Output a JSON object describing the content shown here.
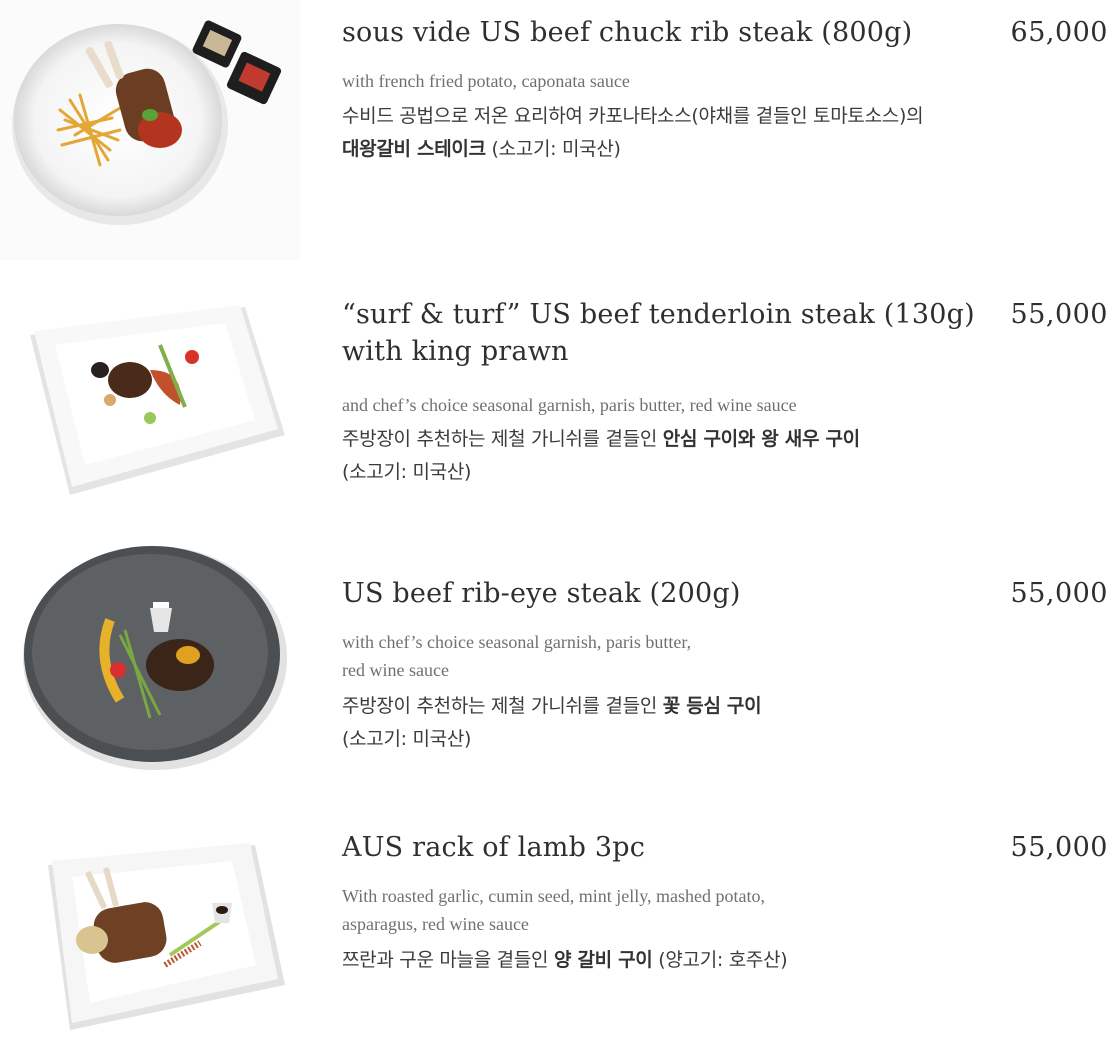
{
  "items": [
    {
      "title": "sous vide US beef chuck rib steak (800g)",
      "price": "65,000",
      "desc_lines": [
        "with french fried potato, caponata sauce"
      ],
      "kr_line1_pre": "수비드 공법으로 저온 요리하여 카포나타소스(야채를 곁들인 토마토소스)의",
      "kr_line2_bold": "대왕갈비 스테이크",
      "kr_line2_post": " (소고기: 미국산)",
      "photo": "steak-on-round-plate-with-fries"
    },
    {
      "title_line1": "“surf & turf” US beef tenderloin steak (130g)",
      "title_line2": "with king prawn",
      "price": "55,000",
      "desc_lines": [
        "and chef’s choice seasonal garnish, paris butter, red wine sauce"
      ],
      "kr_line1_pre": "주방장이 추천하는 제철 가니쉬를 곁들인 ",
      "kr_line1_bold": "안심 구이와 왕 새우 구이",
      "kr_line2_post": "(소고기: 미국산)",
      "photo": "tenderloin-and-prawn-on-square-plate"
    },
    {
      "title": "US beef rib-eye steak (200g)",
      "price": "55,000",
      "desc_lines": [
        "with chef’s choice seasonal garnish, paris butter,",
        "red wine sauce"
      ],
      "kr_line1_pre": "주방장이 추천하는 제철 가니쉬를 곁들인 ",
      "kr_line1_bold": "꽃 등심 구이",
      "kr_line2_post": "(소고기: 미국산)",
      "photo": "rib-eye-on-dark-round-plate"
    },
    {
      "title": "AUS rack of lamb 3pc",
      "price": "55,000",
      "desc_lines": [
        "With roasted garlic, cumin seed, mint jelly, mashed potato,",
        "asparagus, red wine sauce"
      ],
      "kr_line1_pre": "쯔란과 구운 마늘을 곁들인 ",
      "kr_line1_bold": "양 갈비 구이",
      "kr_line1_post": " (양고기: 호주산)",
      "photo": "lamb-rack-on-square-plate"
    }
  ],
  "colors": {
    "title": "#2f2f2f",
    "desc": "#707070",
    "korean": "#3c3c3c"
  }
}
